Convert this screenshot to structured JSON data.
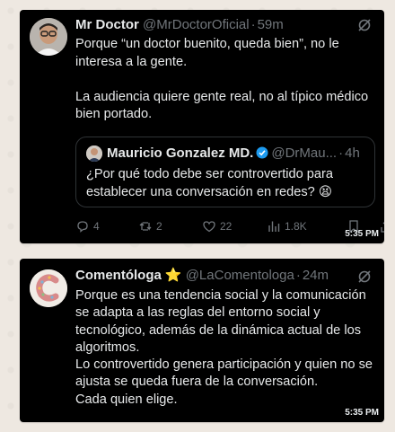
{
  "messages": [
    {
      "author_name": "Mr Doctor",
      "handle": "@MrDoctorOficial",
      "age": "59m",
      "paragraphs": [
        "Porque “un doctor buenito, queda bien”, no le interesa a la gente.",
        "La audiencia quiere gente real, no al típico médico bien portado."
      ],
      "quote": {
        "author_name": "Mauricio Gonzalez MD.",
        "handle": "@DrMau...",
        "age": "4h",
        "text": "¿Por qué todo debe ser controvertido para establecer una conversación en redes?",
        "emoji": "😫"
      },
      "actions": {
        "replies": "4",
        "reposts": "2",
        "likes": "22",
        "views": "1.8K"
      },
      "time": "5:35 PM"
    },
    {
      "author_name": "Comentóloga",
      "badge": "⭐",
      "handle": "@LaComentologa",
      "age": "24m",
      "lines": [
        "Porque es una tendencia social y la comunicación se adapta a las reglas del entorno social y tecnológico, además de la dinámica actual de los algoritmos.",
        "Lo controvertido genera participación y quien no se ajusta se queda fuera de la conversación.",
        "Cada quien elige."
      ],
      "time": "5:35 PM"
    }
  ],
  "colors": {
    "card_bg": "#000000",
    "text": "#e7e9ea",
    "muted": "#71767b",
    "verified_blue": "#1d9bf0",
    "chat_bg": "#eee8e1"
  },
  "icons": [
    "grok-icon",
    "verified-icon",
    "reply-icon",
    "repost-icon",
    "like-icon",
    "views-icon",
    "bookmark-icon",
    "share-icon"
  ]
}
